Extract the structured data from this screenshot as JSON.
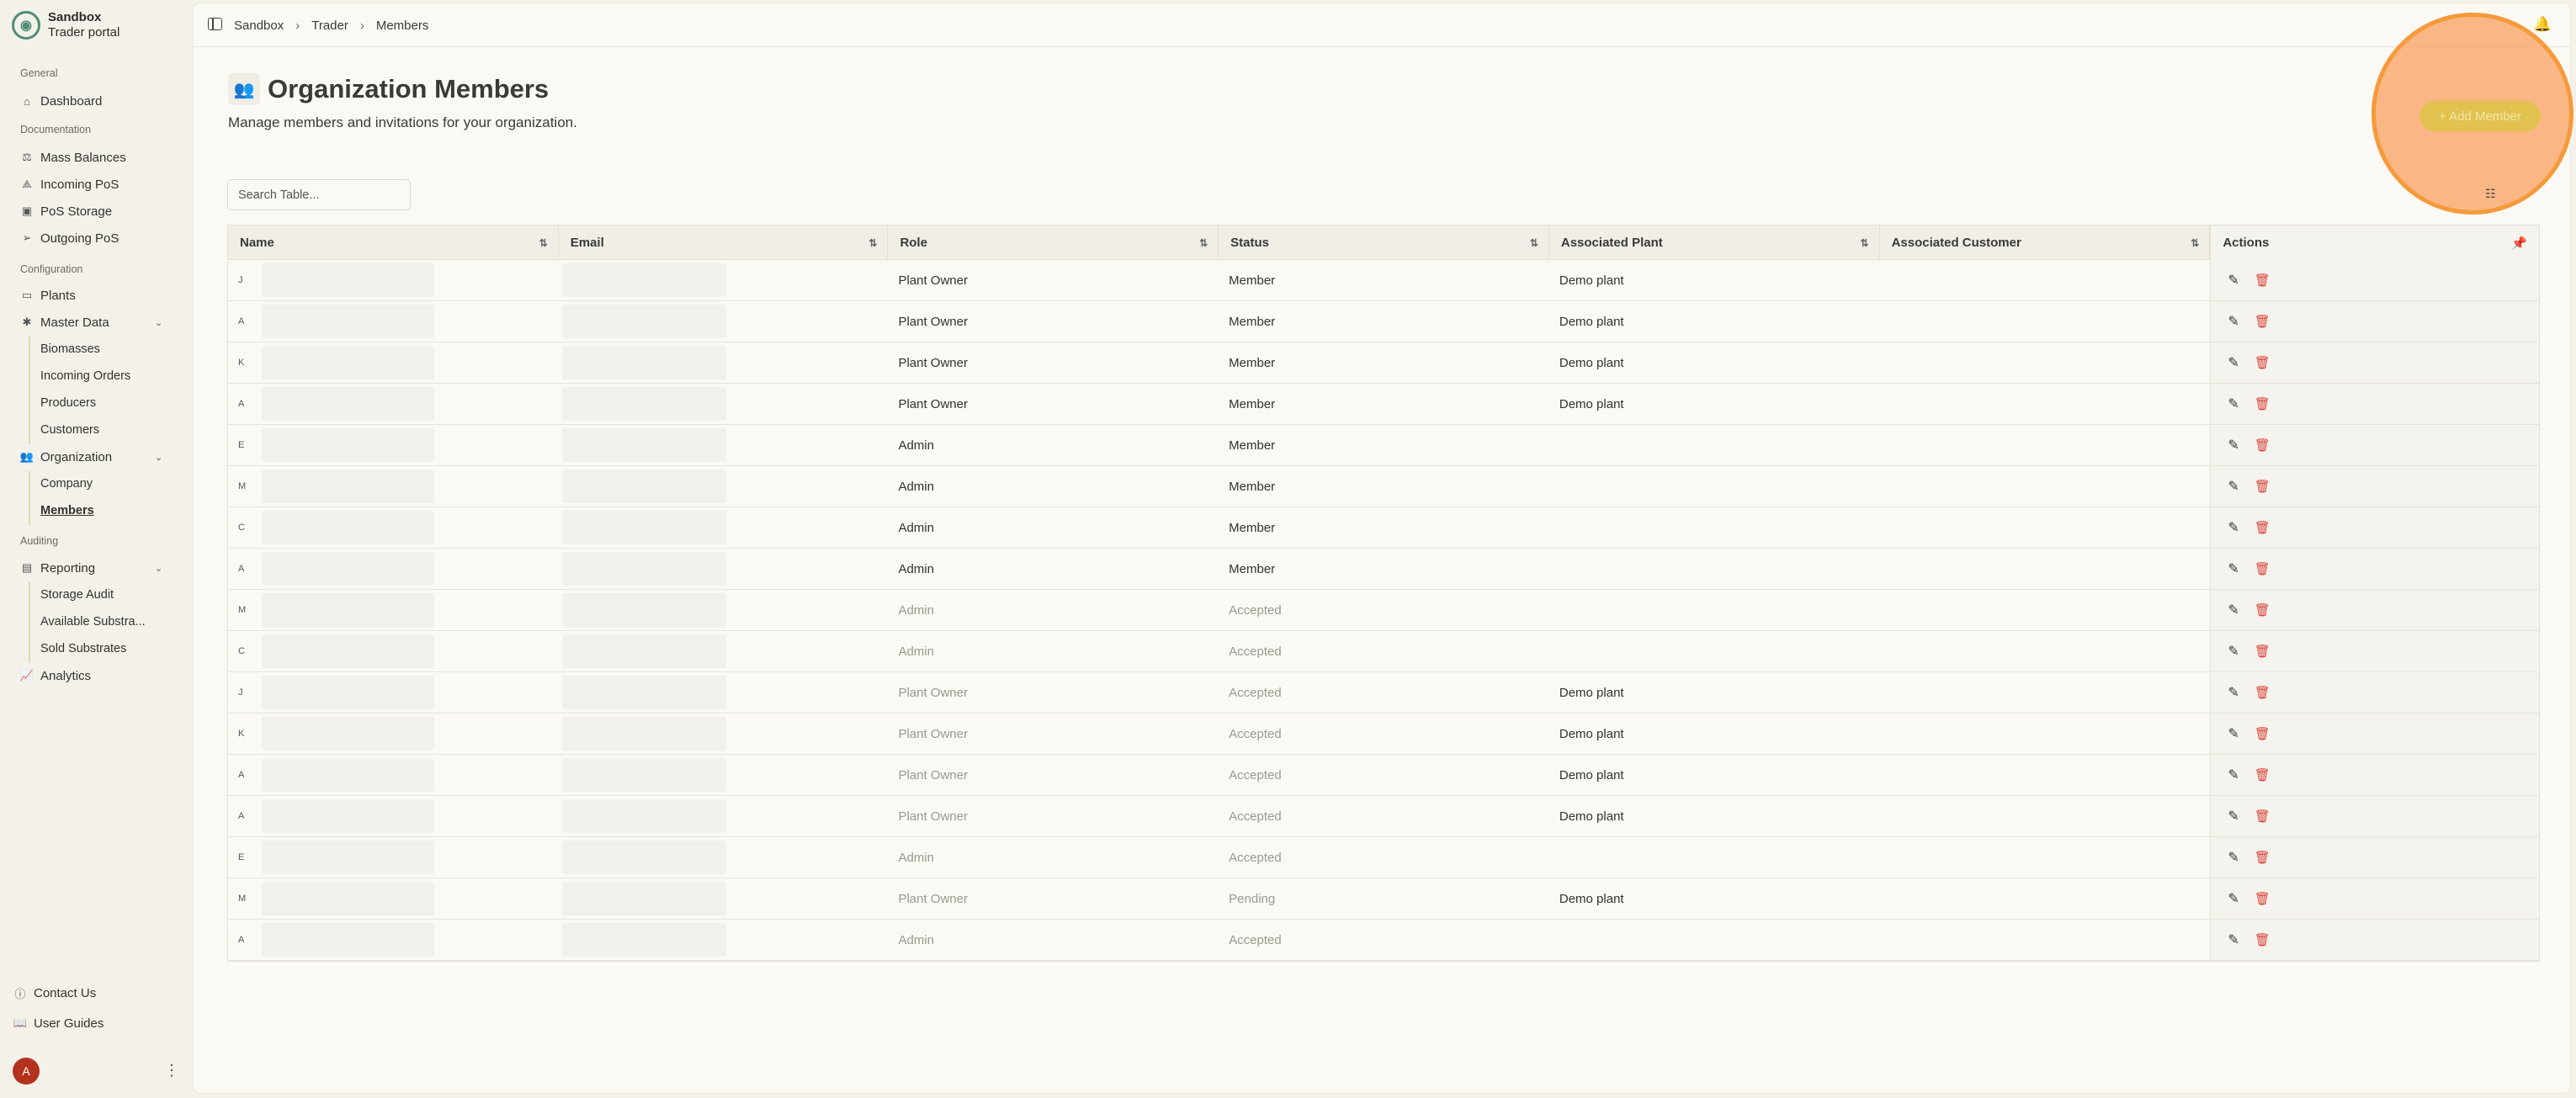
{
  "brand": {
    "title": "Sandbox",
    "subtitle": "Trader portal"
  },
  "sidebar": {
    "groups": {
      "general": "General",
      "documentation": "Documentation",
      "configuration": "Configuration",
      "auditing": "Auditing"
    },
    "items": {
      "dashboard": "Dashboard",
      "mass_balances": "Mass Balances",
      "incoming_pos": "Incoming PoS",
      "pos_storage": "PoS Storage",
      "outgoing_pos": "Outgoing PoS",
      "plants": "Plants",
      "master_data": "Master Data",
      "biomasses": "Biomasses",
      "incoming_orders": "Incoming Orders",
      "producers": "Producers",
      "customers": "Customers",
      "organization": "Organization",
      "company": "Company",
      "members": "Members",
      "reporting": "Reporting",
      "storage_audit": "Storage Audit",
      "available_substrates": "Available Substra...",
      "sold_substrates": "Sold Substrates",
      "analytics": "Analytics",
      "contact_us": "Contact Us",
      "user_guides": "User Guides"
    },
    "avatar_initial": "A"
  },
  "breadcrumb": [
    "Sandbox",
    "Trader",
    "Members"
  ],
  "page": {
    "title": "Organization Members",
    "subtitle": "Manage members and invitations for your organization.",
    "add_button": "+ Add Member"
  },
  "search": {
    "placeholder": "Search Table..."
  },
  "table": {
    "columns": {
      "name": "Name",
      "email": "Email",
      "role": "Role",
      "status": "Status",
      "plant": "Associated Plant",
      "customer": "Associated Customer",
      "actions": "Actions"
    },
    "rows": [
      {
        "initial": "J",
        "role": "Plant Owner",
        "status": "Member",
        "plant": "Demo plant",
        "muted": false
      },
      {
        "initial": "A",
        "role": "Plant Owner",
        "status": "Member",
        "plant": "Demo plant",
        "muted": false
      },
      {
        "initial": "K",
        "role": "Plant Owner",
        "status": "Member",
        "plant": "Demo plant",
        "muted": false
      },
      {
        "initial": "A",
        "role": "Plant Owner",
        "status": "Member",
        "plant": "Demo plant",
        "muted": false
      },
      {
        "initial": "E",
        "role": "Admin",
        "status": "Member",
        "plant": "",
        "muted": false
      },
      {
        "initial": "M",
        "role": "Admin",
        "status": "Member",
        "plant": "",
        "muted": false
      },
      {
        "initial": "C",
        "role": "Admin",
        "status": "Member",
        "plant": "",
        "muted": false
      },
      {
        "initial": "A",
        "role": "Admin",
        "status": "Member",
        "plant": "",
        "muted": false
      },
      {
        "initial": "M",
        "role": "Admin",
        "status": "Accepted",
        "plant": "",
        "muted": true
      },
      {
        "initial": "C",
        "role": "Admin",
        "status": "Accepted",
        "plant": "",
        "muted": true
      },
      {
        "initial": "J",
        "role": "Plant Owner",
        "status": "Accepted",
        "plant": "Demo plant",
        "muted": true
      },
      {
        "initial": "K",
        "role": "Plant Owner",
        "status": "Accepted",
        "plant": "Demo plant",
        "muted": true
      },
      {
        "initial": "A",
        "role": "Plant Owner",
        "status": "Accepted",
        "plant": "Demo plant",
        "muted": true
      },
      {
        "initial": "A",
        "role": "Plant Owner",
        "status": "Accepted",
        "plant": "Demo plant",
        "muted": true
      },
      {
        "initial": "E",
        "role": "Admin",
        "status": "Accepted",
        "plant": "",
        "muted": true
      },
      {
        "initial": "M",
        "role": "Plant Owner",
        "status": "Pending",
        "plant": "Demo plant",
        "muted": true
      },
      {
        "initial": "A",
        "role": "Admin",
        "status": "Accepted",
        "plant": "",
        "muted": true
      }
    ]
  },
  "icons": {
    "edit": "pencil-icon",
    "delete": "trash-icon",
    "pin": "pin-icon",
    "bell": "bell-icon"
  },
  "colors": {
    "accent_button": "#e1c24f",
    "highlight": "#f59a3a",
    "avatar": "#b4321d",
    "delete": "#d9443a",
    "sidebar_active_line": "#d6e1a8"
  }
}
